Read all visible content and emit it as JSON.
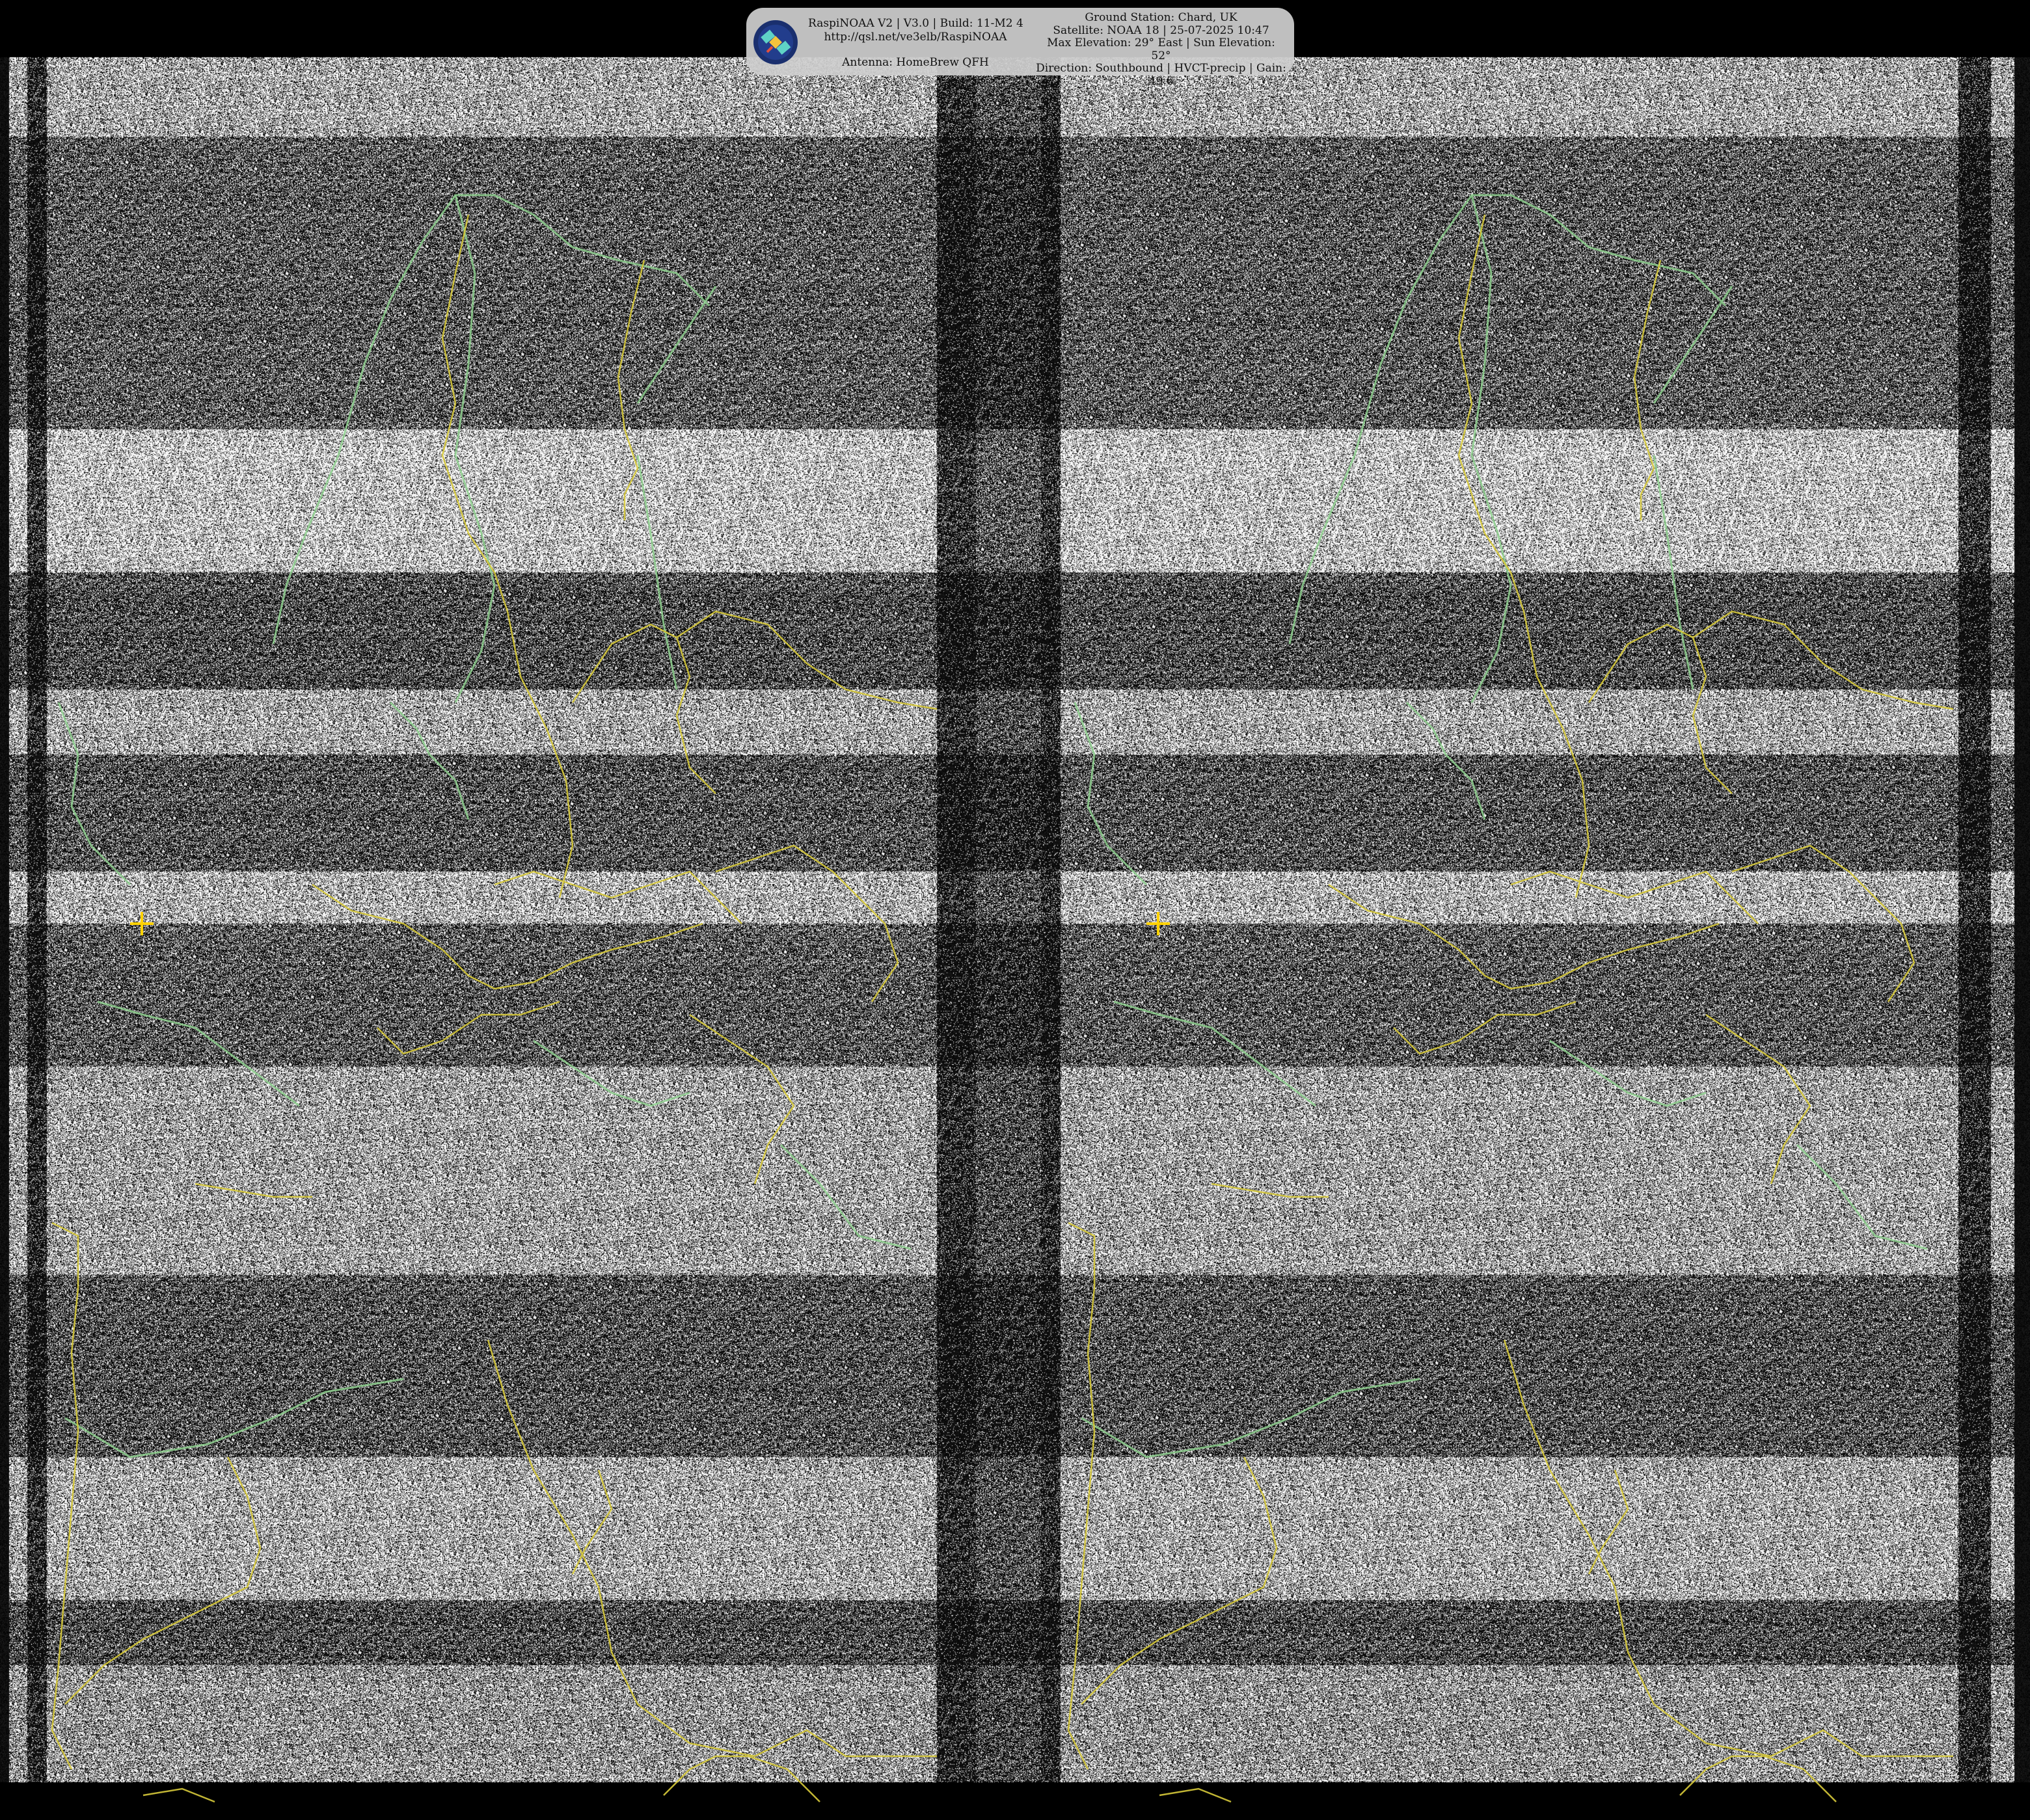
{
  "header": {
    "software": "RaspiNOAA V2 | V3.0 | Build: 11-M2 4",
    "url": "http://qsl.net/ve3elb/RaspiNOAA",
    "antenna": "Antenna: HomeBrew QFH",
    "ground_station": "Ground Station: Chard, UK",
    "satellite": "Satellite: NOAA 18 | 25-07-2025 10:47",
    "elevation": "Max Elevation: 29° East | Sun Elevation: 52°",
    "direction": "Direction: Southbound | HVCT-precip | Gain: 49.6"
  },
  "logo": {
    "icon": "satellite-icon",
    "bg_color": "#1a2f6e",
    "accent": "#5fd3c6"
  },
  "image": {
    "description_colors": {
      "noise_light": "#ffffff",
      "noise_dark": "#000000",
      "coast": "#8fd18f",
      "borders": "#d6c93a",
      "marker": "#ffd200"
    }
  }
}
